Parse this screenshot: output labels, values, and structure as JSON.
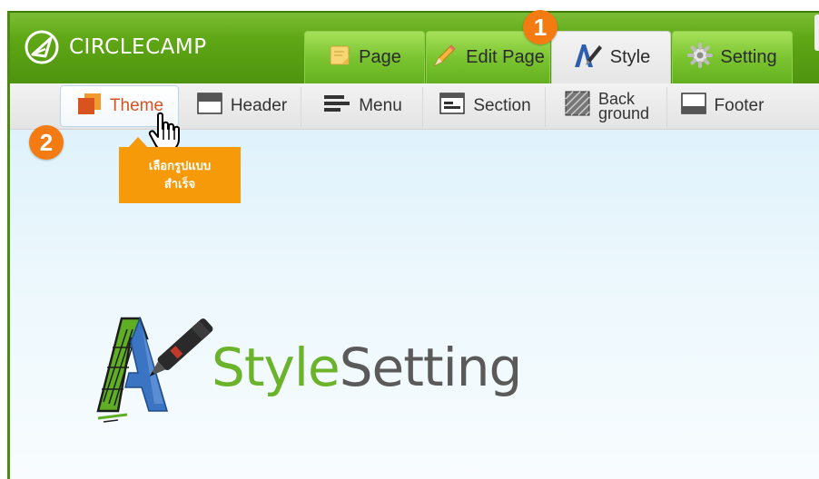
{
  "header": {
    "logo_text": "CIRCLECAMP"
  },
  "tabs": [
    {
      "label": "Page",
      "icon": "note-icon"
    },
    {
      "label": "Edit Page",
      "icon": "pencil-icon"
    },
    {
      "label": "Style",
      "icon": "style-icon",
      "active": true
    },
    {
      "label": "Setting",
      "icon": "gear-icon"
    }
  ],
  "subtoolbar": {
    "items": [
      {
        "label": "Theme",
        "icon": "theme-icon",
        "selected": true
      },
      {
        "label": "Header",
        "icon": "header-icon"
      },
      {
        "label": "Menu",
        "icon": "menu-icon"
      },
      {
        "label": "Section",
        "icon": "section-icon"
      },
      {
        "label_line1": "Back",
        "label_line2": "ground",
        "icon": "background-icon"
      },
      {
        "label": "Footer",
        "icon": "footer-icon"
      }
    ]
  },
  "badges": {
    "step1": "1",
    "step2": "2"
  },
  "tooltip": {
    "line1": "เลือกรูปแบบ",
    "line2": "สำเร็จ"
  },
  "hero": {
    "word1": "Style",
    "word2": "Setting"
  },
  "colors": {
    "brand_green": "#5aa013",
    "tab_green": "#7cc531",
    "accent_orange": "#f47b12",
    "tooltip_orange": "#f79a0a",
    "hero_green": "#6ab32b",
    "hero_gray": "#5a5a5a"
  }
}
